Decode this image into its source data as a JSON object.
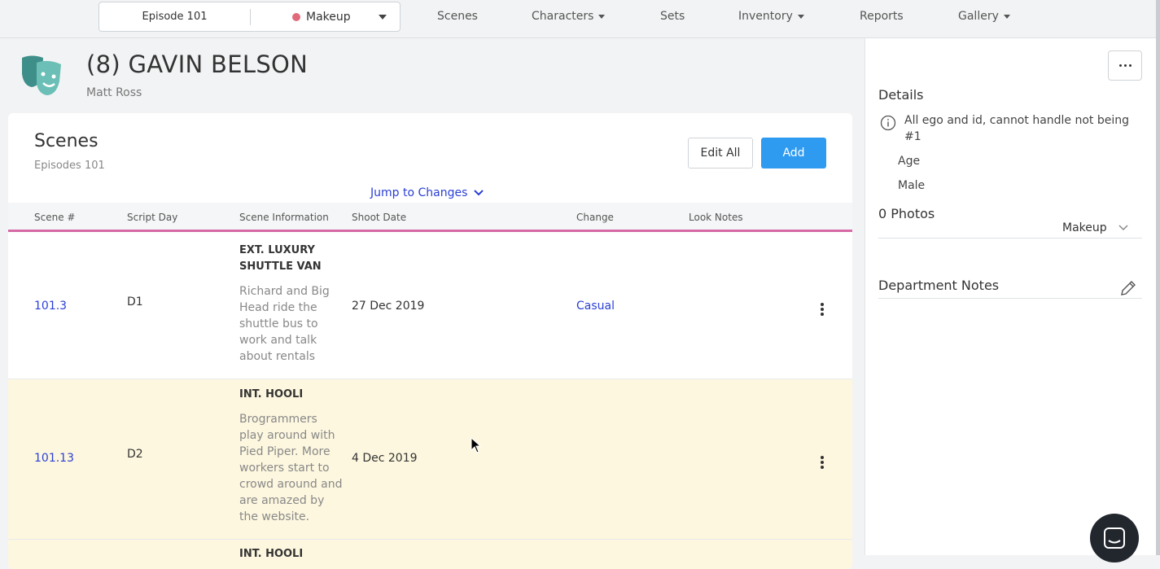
{
  "topbar": {
    "episode_select": "Episode 101",
    "department_select": "Makeup",
    "department_dot_color": "#e06a7a",
    "nav": [
      {
        "label": "Scenes",
        "dropdown": false
      },
      {
        "label": "Characters",
        "dropdown": true
      },
      {
        "label": "Sets",
        "dropdown": false
      },
      {
        "label": "Inventory",
        "dropdown": true
      },
      {
        "label": "Reports",
        "dropdown": false
      },
      {
        "label": "Gallery",
        "dropdown": true
      }
    ]
  },
  "character": {
    "icon": "theater-masks-icon",
    "title": "(8) GAVIN BELSON",
    "actor": "Matt Ross"
  },
  "scenes_panel": {
    "title": "Scenes",
    "subtitle": "Episodes 101",
    "edit_all_label": "Edit All",
    "add_label": "Add",
    "jump_label": "Jump to Changes",
    "columns": [
      "Scene #",
      "Script Day",
      "Scene Information",
      "Shoot Date",
      "Change",
      "Look Notes"
    ],
    "rows": [
      {
        "scene": "101.3",
        "script_day": "D1",
        "set": "EXT. LUXURY SHUTTLE VAN",
        "synopsis": "Richard and Big Head ride the shuttle bus to work and talk about rentals",
        "shoot_date": "27 Dec 2019",
        "change": "Casual",
        "look_notes": ""
      },
      {
        "scene": "101.13",
        "script_day": "D2",
        "set": "INT. HOOLI",
        "synopsis": "Brogrammers play around with Pied Piper. More workers start to crowd around and are amazed by the website.",
        "shoot_date": "4 Dec 2019",
        "change": "",
        "look_notes": ""
      },
      {
        "scene": "",
        "script_day": "",
        "set": "INT. HOOLI",
        "synopsis": "",
        "shoot_date": "",
        "change": "",
        "look_notes": ""
      }
    ]
  },
  "details_panel": {
    "details_title": "Details",
    "description": "All ego and id, cannot handle not being #1",
    "age_label": "Age",
    "gender": "Male",
    "photos_title": "0 Photos",
    "photos_department": "Makeup",
    "dept_notes_title": "Department Notes"
  },
  "colors": {
    "accent_blue": "#2f9bf0",
    "link_blue": "#2a3fd6",
    "header_underline": "#d66aa5",
    "highlight_row": "#fdf7df",
    "mask_teal": "#4a9e98"
  }
}
